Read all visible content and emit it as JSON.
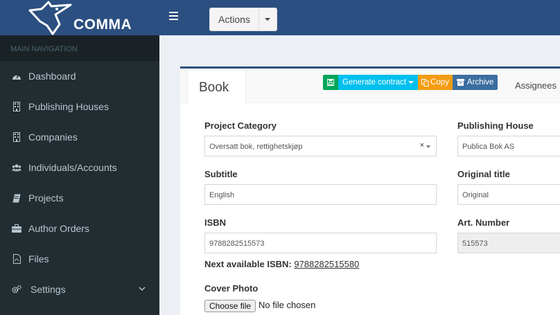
{
  "brand": {
    "name": "COMMA"
  },
  "sidebar": {
    "header": "MAIN NAVIGATION",
    "items": [
      {
        "label": "Dashboard",
        "icon": "dashboard-icon"
      },
      {
        "label": "Publishing Houses",
        "icon": "building-icon"
      },
      {
        "label": "Companies",
        "icon": "building-icon"
      },
      {
        "label": "Individuals/Accounts",
        "icon": "users-icon"
      },
      {
        "label": "Projects",
        "icon": "book-icon"
      },
      {
        "label": "Author Orders",
        "icon": "briefcase-icon"
      },
      {
        "label": "Files",
        "icon": "file-icon"
      },
      {
        "label": "Settings",
        "icon": "gears-icon"
      }
    ]
  },
  "topbar": {
    "actions_label": "Actions"
  },
  "tabs": {
    "active": "Book",
    "assignees": "Assignees"
  },
  "toolbar": {
    "generate_contract": "Generate contract",
    "copy": "Copy",
    "archive": "Archive"
  },
  "form": {
    "project_category": {
      "label": "Project Category",
      "value": "Oversatt bok, rettighetskjøp"
    },
    "publishing_house": {
      "label": "Publishing House",
      "value": "Publica Bok AS"
    },
    "subtitle": {
      "label": "Subtitle",
      "value": "English"
    },
    "original_title": {
      "label": "Original title",
      "value": "Original"
    },
    "isbn": {
      "label": "ISBN",
      "value": "9788282515573"
    },
    "art_number": {
      "label": "Art. Number",
      "value": "515573"
    },
    "next_isbn": {
      "label": "Next available ISBN:",
      "value": "9788282515580"
    },
    "cover_photo": {
      "label": "Cover Photo",
      "button": "Choose file",
      "status": "No file chosen"
    }
  },
  "colors": {
    "header_blue": "#2b4f80",
    "sidebar_dark": "#222d32",
    "green": "#00a65a",
    "cyan": "#00c0ef",
    "orange": "#f39c12"
  }
}
